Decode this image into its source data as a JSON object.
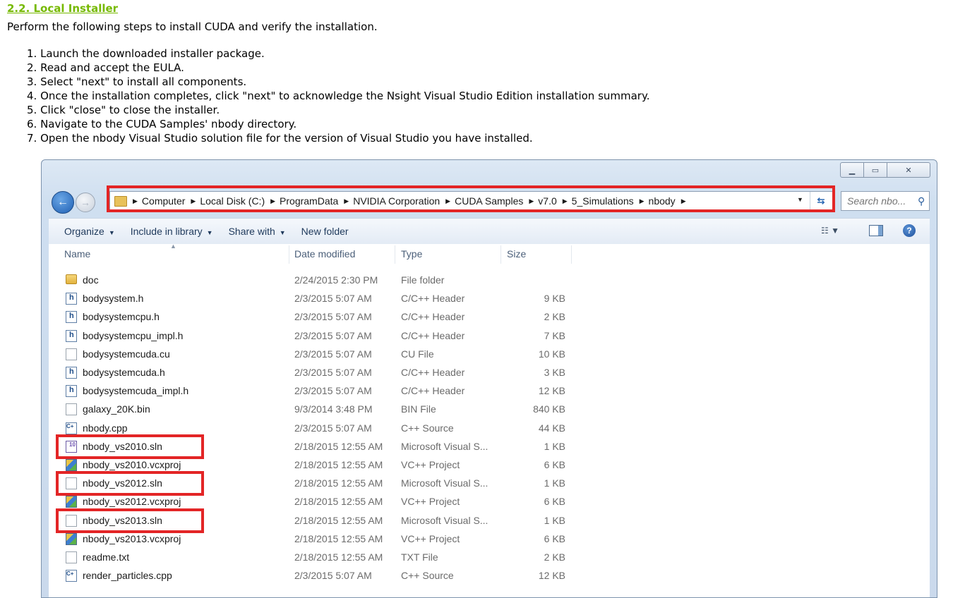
{
  "doc": {
    "heading": "2.2. Local Installer",
    "intro": "Perform the following steps to install CUDA and verify the installation.",
    "steps": [
      "1. Launch the downloaded installer package.",
      "2. Read and accept the EULA.",
      "3. Select \"next\" to install all components.",
      "4. Once the installation completes, click \"next\" to acknowledge the Nsight Visual Studio Edition installation summary.",
      "5. Click \"close\" to close the installer.",
      "6. Navigate to the CUDA Samples' nbody directory.",
      "7. Open the nbody Visual Studio solution file for the version of Visual Studio you have installed."
    ]
  },
  "explorer": {
    "breadcrumbs": [
      "Computer",
      "Local Disk (C:)",
      "ProgramData",
      "NVIDIA Corporation",
      "CUDA Samples",
      "v7.0",
      "5_Simulations",
      "nbody"
    ],
    "search_placeholder": "Search nbo...",
    "toolbar": {
      "organize": "Organize",
      "include_in_library": "Include in library",
      "share_with": "Share with",
      "new_folder": "New folder"
    },
    "columns": {
      "name": "Name",
      "date_modified": "Date modified",
      "type": "Type",
      "size": "Size"
    },
    "files": [
      {
        "name": "doc",
        "date": "2/24/2015 2:30 PM",
        "type": "File folder",
        "size": "",
        "icon": "folder-icon"
      },
      {
        "name": "bodysystem.h",
        "date": "2/3/2015 5:07 AM",
        "type": "C/C++ Header",
        "size": "9 KB",
        "icon": "header-file-icon"
      },
      {
        "name": "bodysystemcpu.h",
        "date": "2/3/2015 5:07 AM",
        "type": "C/C++ Header",
        "size": "2 KB",
        "icon": "header-file-icon"
      },
      {
        "name": "bodysystemcpu_impl.h",
        "date": "2/3/2015 5:07 AM",
        "type": "C/C++ Header",
        "size": "7 KB",
        "icon": "header-file-icon"
      },
      {
        "name": "bodysystemcuda.cu",
        "date": "2/3/2015 5:07 AM",
        "type": "CU File",
        "size": "10 KB",
        "icon": "blank-file-icon"
      },
      {
        "name": "bodysystemcuda.h",
        "date": "2/3/2015 5:07 AM",
        "type": "C/C++ Header",
        "size": "3 KB",
        "icon": "header-file-icon"
      },
      {
        "name": "bodysystemcuda_impl.h",
        "date": "2/3/2015 5:07 AM",
        "type": "C/C++ Header",
        "size": "12 KB",
        "icon": "header-file-icon"
      },
      {
        "name": "galaxy_20K.bin",
        "date": "9/3/2014 3:48 PM",
        "type": "BIN File",
        "size": "840 KB",
        "icon": "blank-file-icon"
      },
      {
        "name": "nbody.cpp",
        "date": "2/3/2015 5:07 AM",
        "type": "C++ Source",
        "size": "44 KB",
        "icon": "cpp-file-icon"
      },
      {
        "name": "nbody_vs2010.sln",
        "date": "2/18/2015 12:55 AM",
        "type": "Microsoft Visual S...",
        "size": "1 KB",
        "icon": "vs-solution-icon",
        "highlighted": true
      },
      {
        "name": "nbody_vs2010.vcxproj",
        "date": "2/18/2015 12:55 AM",
        "type": "VC++ Project",
        "size": "6 KB",
        "icon": "vcxproj-file-icon"
      },
      {
        "name": "nbody_vs2012.sln",
        "date": "2/18/2015 12:55 AM",
        "type": "Microsoft Visual S...",
        "size": "1 KB",
        "icon": "blank-file-icon",
        "highlighted": true
      },
      {
        "name": "nbody_vs2012.vcxproj",
        "date": "2/18/2015 12:55 AM",
        "type": "VC++ Project",
        "size": "6 KB",
        "icon": "vcxproj-file-icon"
      },
      {
        "name": "nbody_vs2013.sln",
        "date": "2/18/2015 12:55 AM",
        "type": "Microsoft Visual S...",
        "size": "1 KB",
        "icon": "blank-file-icon",
        "highlighted": true
      },
      {
        "name": "nbody_vs2013.vcxproj",
        "date": "2/18/2015 12:55 AM",
        "type": "VC++ Project",
        "size": "6 KB",
        "icon": "vcxproj-file-icon"
      },
      {
        "name": "readme.txt",
        "date": "2/18/2015 12:55 AM",
        "type": "TXT File",
        "size": "2 KB",
        "icon": "text-file-icon"
      },
      {
        "name": "render_particles.cpp",
        "date": "2/3/2015 5:07 AM",
        "type": "C++ Source",
        "size": "12 KB",
        "icon": "cpp-file-icon"
      }
    ],
    "highlight_color": "#e32526"
  }
}
